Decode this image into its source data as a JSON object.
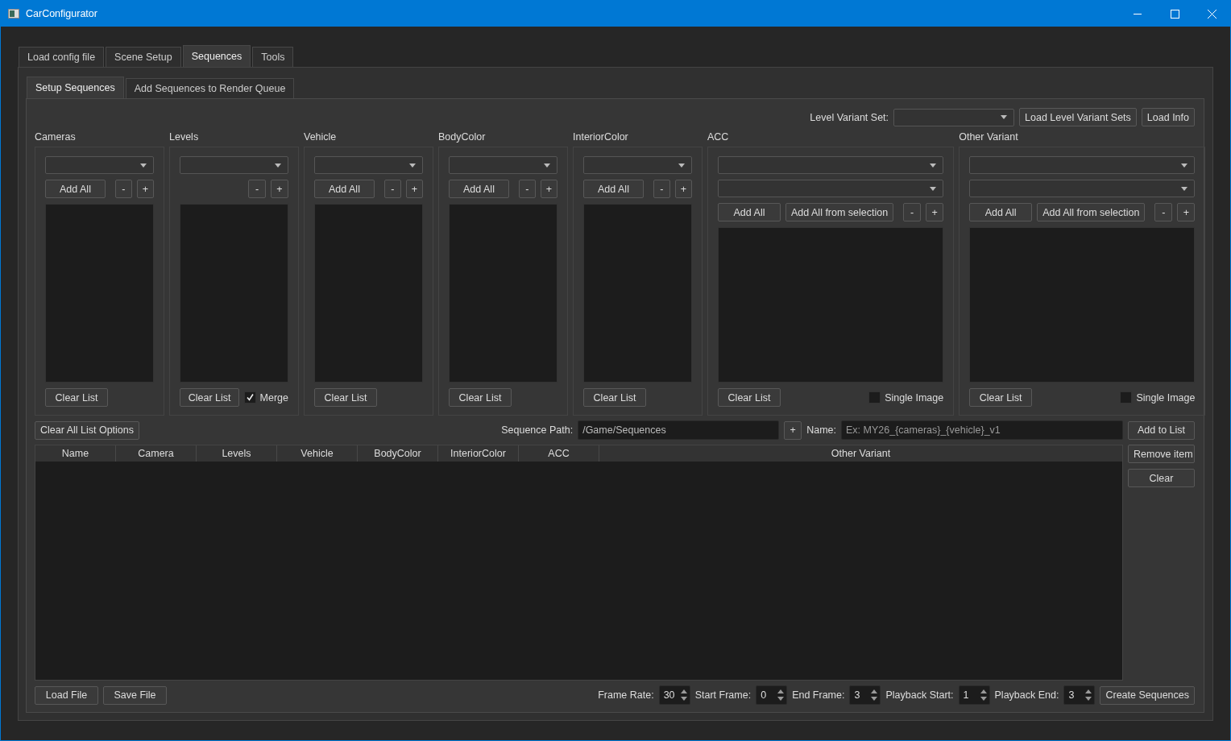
{
  "window": {
    "title": "CarConfigurator"
  },
  "tabs": [
    {
      "label": "Load config file",
      "selected": false
    },
    {
      "label": "Scene Setup",
      "selected": false
    },
    {
      "label": "Sequences",
      "selected": true
    },
    {
      "label": "Tools",
      "selected": false
    }
  ],
  "subtabs": [
    {
      "label": "Setup Sequences",
      "selected": true
    },
    {
      "label": "Add Sequences to Render Queue",
      "selected": false
    }
  ],
  "level_variant": {
    "label": "Level Variant Set:",
    "buttons": [
      "Load Level Variant Sets",
      "Load Info"
    ]
  },
  "panels": [
    {
      "kind": "simple",
      "title": "Cameras",
      "add_all": "Add All",
      "minus": "-",
      "plus": "+",
      "clear": "Clear List"
    },
    {
      "kind": "levels",
      "title": "Levels",
      "minus": "-",
      "plus": "+",
      "clear": "Clear List",
      "checkbox": {
        "label": "Merge",
        "checked": true
      }
    },
    {
      "kind": "simple",
      "title": "Vehicle",
      "add_all": "Add All",
      "minus": "-",
      "plus": "+",
      "clear": "Clear List"
    },
    {
      "kind": "simple",
      "title": "BodyColor",
      "add_all": "Add All",
      "minus": "-",
      "plus": "+",
      "clear": "Clear List"
    },
    {
      "kind": "simple",
      "title": "InteriorColor",
      "add_all": "Add All",
      "minus": "-",
      "plus": "+",
      "clear": "Clear List"
    },
    {
      "kind": "variant",
      "title": "ACC",
      "add_all": "Add All",
      "add_selection": "Add All from selection",
      "minus": "-",
      "plus": "+",
      "clear": "Clear List",
      "checkbox": {
        "label": "Single Image",
        "checked": false
      }
    },
    {
      "kind": "variant",
      "title": "Other Variant",
      "add_all": "Add All",
      "add_selection": "Add All from selection",
      "minus": "-",
      "plus": "+",
      "clear": "Clear List",
      "checkbox": {
        "label": "Single Image",
        "checked": false
      }
    }
  ],
  "sequence": {
    "clear_all": "Clear All List Options",
    "path_label": "Sequence Path:",
    "path": "/Game/Sequences",
    "plus": "+",
    "name_label": "Name:",
    "name_placeholder": "Ex: MY26_{cameras}_{vehicle}_v1",
    "add": "Add to List"
  },
  "table": {
    "columns": [
      "Name",
      "Camera",
      "Levels",
      "Vehicle",
      "BodyColor",
      "InteriorColor",
      "ACC",
      "Other Variant"
    ]
  },
  "side_buttons": [
    "Remove item",
    "Clear"
  ],
  "file_buttons": [
    "Load File",
    "Save File"
  ],
  "spinners": [
    {
      "label": "Frame Rate:",
      "value": "30"
    },
    {
      "label": "Start Frame:",
      "value": "0"
    },
    {
      "label": "End Frame:",
      "value": "3"
    },
    {
      "label": "Playback Start:",
      "value": "1"
    },
    {
      "label": "Playback End:",
      "value": "3"
    }
  ],
  "create": "Create Sequences"
}
